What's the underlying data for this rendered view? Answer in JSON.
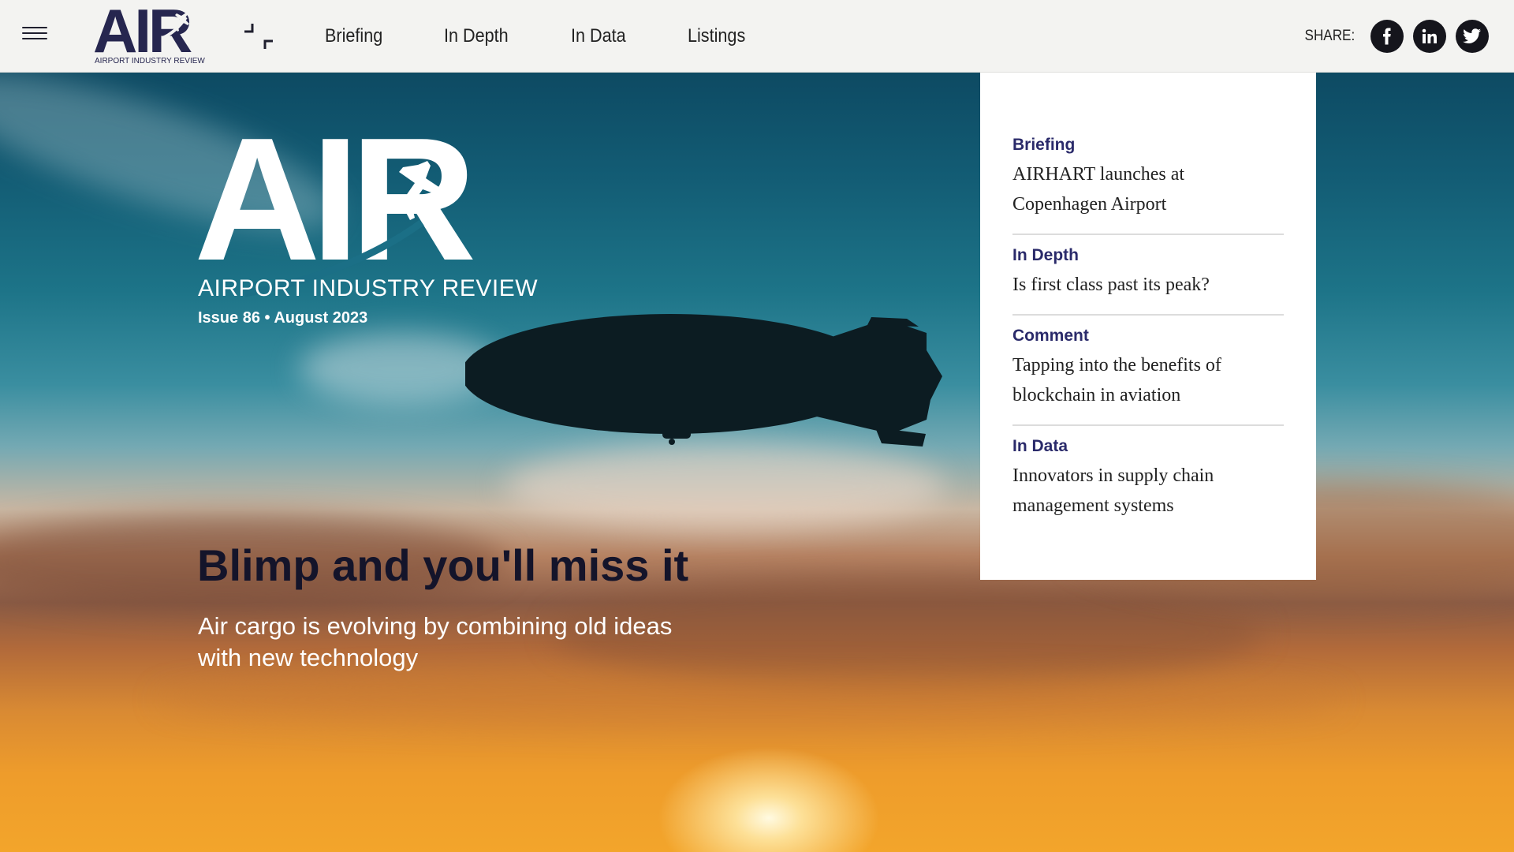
{
  "header": {
    "brand_word": "AIR",
    "brand_sub": "AIRPORT INDUSTRY REVIEW",
    "nav": [
      {
        "label": "Briefing"
      },
      {
        "label": "In Depth"
      },
      {
        "label": "In Data"
      },
      {
        "label": "Listings"
      }
    ],
    "share_label": "SHARE:",
    "social": [
      {
        "icon": "facebook-icon",
        "glyph": "f"
      },
      {
        "icon": "linkedin-icon",
        "glyph": "in"
      },
      {
        "icon": "twitter-icon",
        "glyph": "t"
      }
    ]
  },
  "hero": {
    "logo_word": "AIR",
    "logo_sub": "AIRPORT INDUSTRY REVIEW",
    "issue": "Issue 86 • August 2023",
    "headline": "Blimp and you'll miss it",
    "subline": "Air cargo is evolving by combining old ideas with new technology"
  },
  "panel": {
    "stories": [
      {
        "category": "Briefing",
        "title": "AIRHART launches at Copenhagen Airport"
      },
      {
        "category": "In Depth",
        "title": "Is first class past its peak?"
      },
      {
        "category": "Comment",
        "title": "Tapping into the benefits of blockchain in aviation"
      },
      {
        "category": "In Data",
        "title": "Innovators in supply chain management systems"
      }
    ]
  },
  "colors": {
    "brand_navy": "#26264f",
    "category": "#2a2a6a",
    "bar_bg": "#f3f3f1"
  }
}
